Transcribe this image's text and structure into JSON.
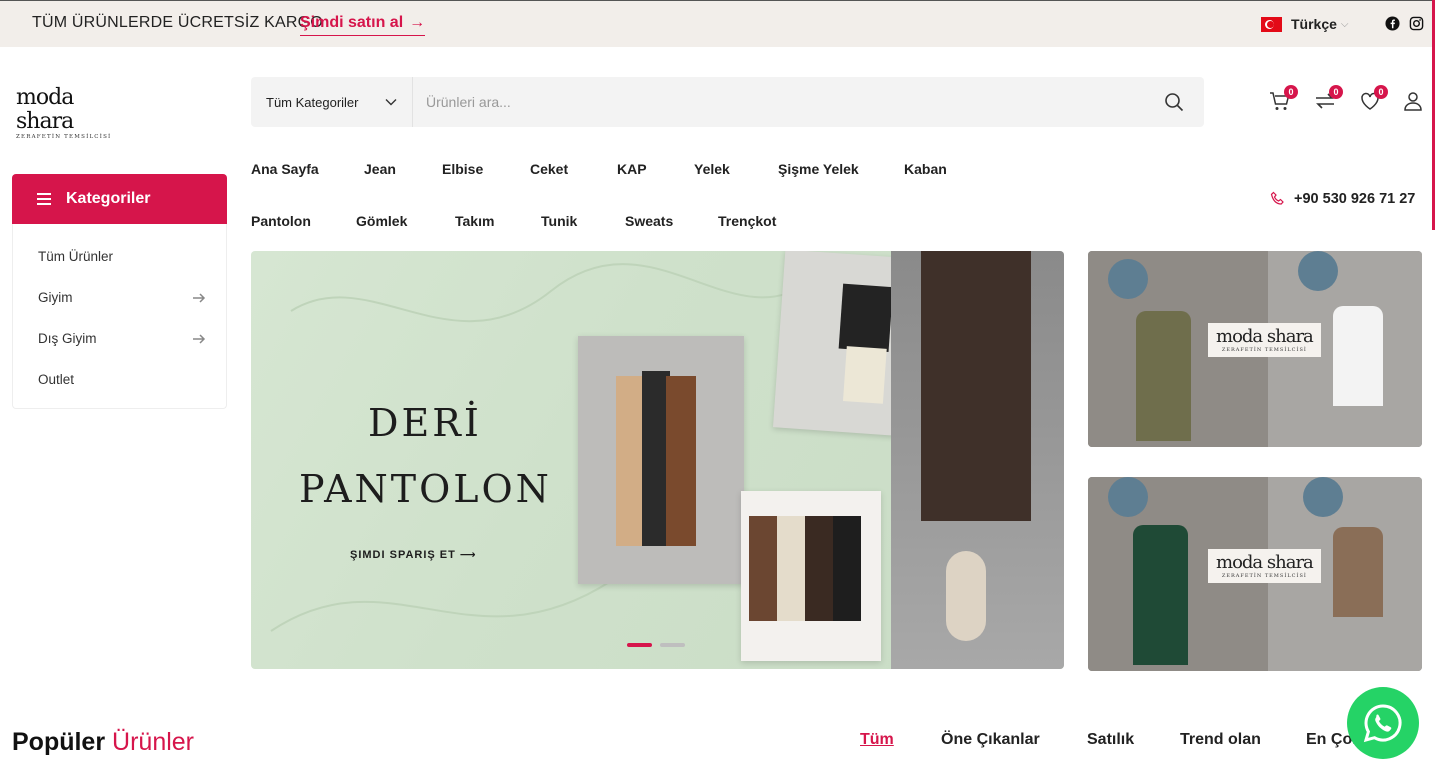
{
  "topbar": {
    "promo": "TÜM ÜRÜNLERDE ÜCRETSİZ KARGO",
    "cta": "Şimdi satın al",
    "cta_arrow": "→",
    "language": "Türkçe"
  },
  "logo": {
    "name": "moda shara",
    "tagline": "ZERAFETİN TEMSİLCİSİ"
  },
  "search": {
    "category": "Tüm Kategoriler",
    "placeholder": "Ürünleri ara..."
  },
  "header": {
    "cart_count": "0",
    "compare_count": "0",
    "wishlist_count": "0"
  },
  "categories": {
    "title": "Kategoriler",
    "items": [
      {
        "label": "Tüm Ürünler",
        "has_sub": false
      },
      {
        "label": "Giyim",
        "has_sub": true
      },
      {
        "label": "Dış Giyim",
        "has_sub": true
      },
      {
        "label": "Outlet",
        "has_sub": false
      }
    ]
  },
  "nav": {
    "row1": [
      "Ana Sayfa",
      "Jean",
      "Elbise",
      "Ceket",
      "KAP",
      "Yelek",
      "Şişme Yelek",
      "Kaban"
    ],
    "row2": [
      "Pantolon",
      "Gömlek",
      "Takım",
      "Tunik",
      "Sweats",
      "Trençkot"
    ]
  },
  "phone": "+90 530 926 71 27",
  "hero": {
    "line1": "DERİ",
    "line2": "PANTOLON",
    "cta": "ŞIMDI SPARIŞ ET ⟶",
    "slide_active": 1,
    "slide_total": 2
  },
  "popular": {
    "title_bold": "Popüler",
    "title_light": "Ürünler",
    "tabs": [
      "Tüm",
      "Öne Çıkanlar",
      "Satılık",
      "Trend olan",
      "En Çok Satan"
    ]
  },
  "colors": {
    "accent": "#d6154b",
    "topbar_bg": "#f2eeea",
    "whatsapp": "#25d366"
  }
}
